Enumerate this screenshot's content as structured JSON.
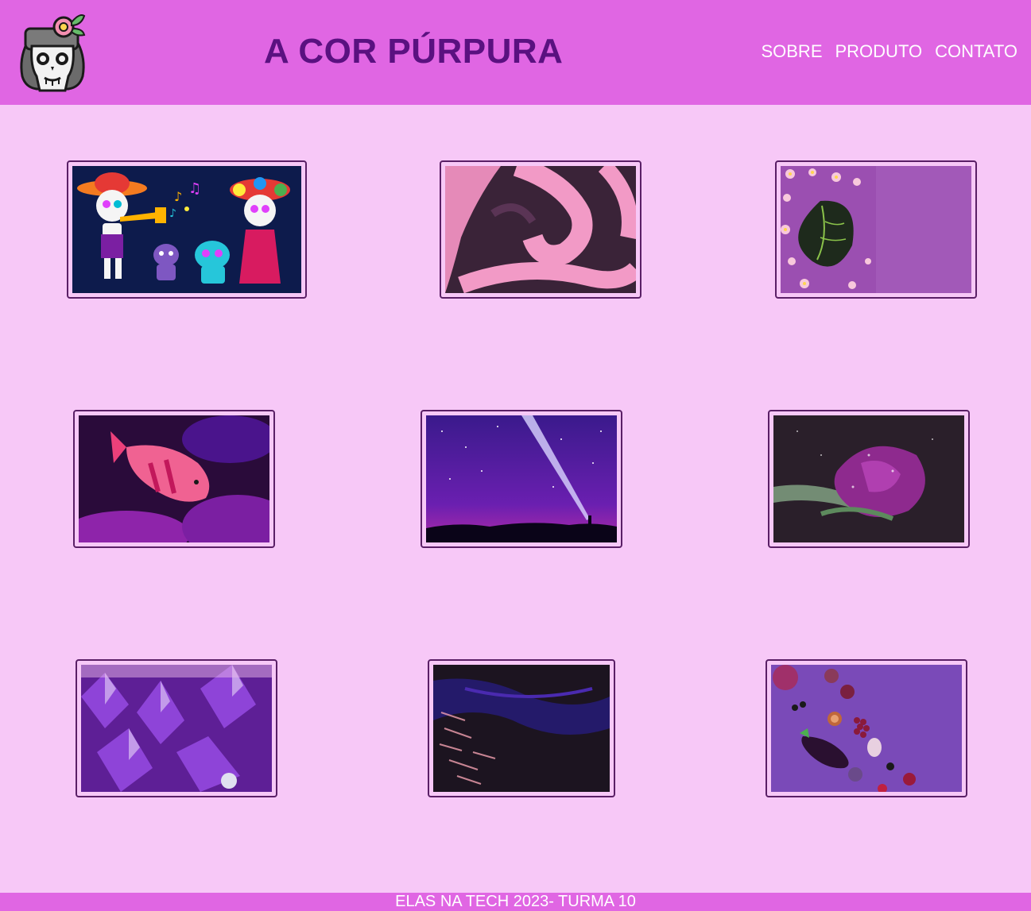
{
  "header": {
    "title": "A COR PÚRPURA",
    "logo_icon": "sugar-skull-icon",
    "nav": [
      {
        "label": "SOBRE"
      },
      {
        "label": "PRODUTO"
      },
      {
        "label": "CONTATO"
      }
    ]
  },
  "gallery": {
    "images": [
      {
        "icon": "day-of-dead-skeletons-image"
      },
      {
        "icon": "pink-graffiti-wall-image"
      },
      {
        "icon": "leaf-and-flowers-image"
      },
      {
        "icon": "pink-fish-coral-image"
      },
      {
        "icon": "starry-night-flashlight-image"
      },
      {
        "icon": "purple-rose-image"
      },
      {
        "icon": "amethyst-crystals-image"
      },
      {
        "icon": "dark-purple-water-image"
      },
      {
        "icon": "purple-vegetables-image"
      }
    ]
  },
  "footer": {
    "text": "ELAS NA TECH 2023- TURMA 10"
  },
  "colors": {
    "header_bg": "#e066e3",
    "page_bg": "#f7c8f7",
    "title": "#5a1180",
    "card_border": "#5a1f66"
  }
}
